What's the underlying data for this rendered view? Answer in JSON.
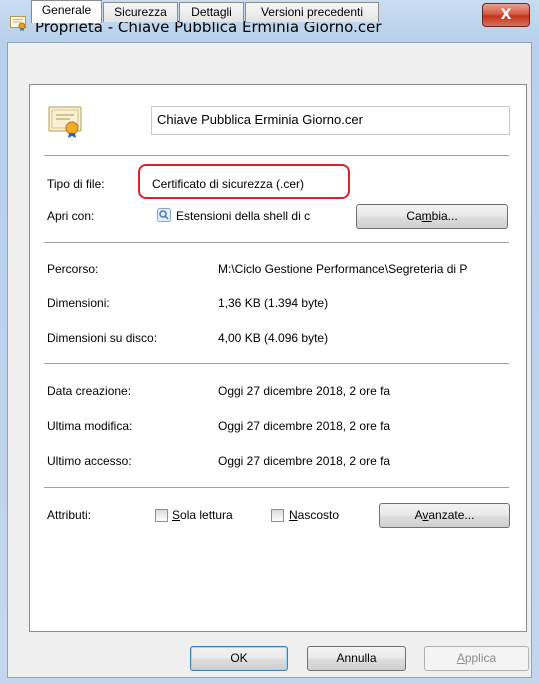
{
  "window": {
    "title": "Proprietà - Chiave Pubblica Erminia Giorno.cer",
    "close_glyph": "X"
  },
  "tabs": [
    "Generale",
    "Sicurezza",
    "Dettagli",
    "Versioni precedenti"
  ],
  "active_tab": "Generale",
  "file": {
    "name": "Chiave Pubblica Erminia Giorno.cer",
    "type_label": "Tipo di file:",
    "type_value": "Certificato di sicurezza (.cer)",
    "open_with_label": "Apri con:",
    "open_with_value": "Estensioni della shell di c",
    "change_button": {
      "pre": "Ca",
      "accel": "m",
      "post": "bia..."
    }
  },
  "location": {
    "path_label": "Percorso:",
    "path_value": "M:\\Ciclo Gestione Performance\\Segreteria di P",
    "size_label": "Dimensioni:",
    "size_value": "1,36 KB (1.394 byte)",
    "disk_size_label": "Dimensioni su disco:",
    "disk_size_value": "4,00 KB (4.096 byte)"
  },
  "dates": {
    "created_label": "Data creazione:",
    "created_value": "Oggi 27 dicembre 2018, 2 ore fa",
    "modified_label": "Ultima modifica:",
    "modified_value": "Oggi 27 dicembre 2018, 2 ore fa",
    "accessed_label": "Ultimo accesso:",
    "accessed_value": "Oggi 27 dicembre 2018, 2 ore fa"
  },
  "attributes": {
    "label": "Attributi:",
    "readonly": {
      "accel": "S",
      "rest": "ola lettura",
      "checked": false
    },
    "hidden": {
      "accel": "N",
      "rest": "ascosto",
      "checked": false
    },
    "advanced_button": {
      "pre": "A",
      "accel": "v",
      "post": "anzate..."
    }
  },
  "footer": {
    "ok": "OK",
    "cancel": "Annulla",
    "apply": {
      "accel": "A",
      "rest": "pplica"
    }
  },
  "colors": {
    "highlight_outline": "#e0202a",
    "close_button": "#c2321c"
  }
}
